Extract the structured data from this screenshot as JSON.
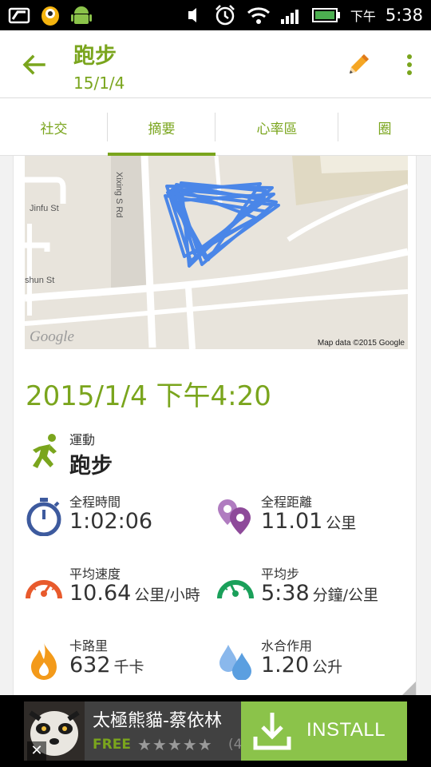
{
  "status_bar": {
    "time": "5:38",
    "ampm": "下午"
  },
  "app_bar": {
    "title": "跑步",
    "subtitle": "15/1/4"
  },
  "tabs": [
    {
      "label": "社交"
    },
    {
      "label": "摘要"
    },
    {
      "label": "心率區"
    },
    {
      "label": "圈"
    }
  ],
  "map": {
    "credit": "Map data ©2015 Google",
    "logo": "Google",
    "streets": [
      "Jinfu St",
      "Xixing S Rd",
      "shun St"
    ]
  },
  "summary": {
    "date": "2015/1/4 下午4:20",
    "activity_label": "運動",
    "activity_value": "跑步",
    "stats": [
      {
        "label": "全程時間",
        "value": "1:02:06",
        "unit": "",
        "icon": "stopwatch-icon",
        "color": "#3d5a9e"
      },
      {
        "label": "全程距離",
        "value": "11.01",
        "unit": "公里",
        "icon": "map-pin-icon",
        "color": "#8e4a9a"
      },
      {
        "label": "平均速度",
        "value": "10.64",
        "unit": "公里/小時",
        "icon": "speed-gauge-icon",
        "color": "#e85a2c"
      },
      {
        "label": "平均步",
        "value": "5:38",
        "unit": "分鐘/公里",
        "icon": "pace-gauge-icon",
        "color": "#1aa05a"
      },
      {
        "label": "卡路里",
        "value": "632",
        "unit": "千卡",
        "icon": "flame-icon",
        "color": "#f39a1a"
      },
      {
        "label": "水合作用",
        "value": "1.20",
        "unit": "公升",
        "icon": "water-drops-icon",
        "color": "#5b9fe0"
      }
    ]
  },
  "ad": {
    "title": "太極熊貓-蔡依林",
    "free_label": "FREE",
    "stars": "★★★★★",
    "rating": "(4",
    "install_label": "INSTALL",
    "close": "✕"
  },
  "colors": {
    "accent": "#7aa51d",
    "route": "#4a86e8"
  }
}
